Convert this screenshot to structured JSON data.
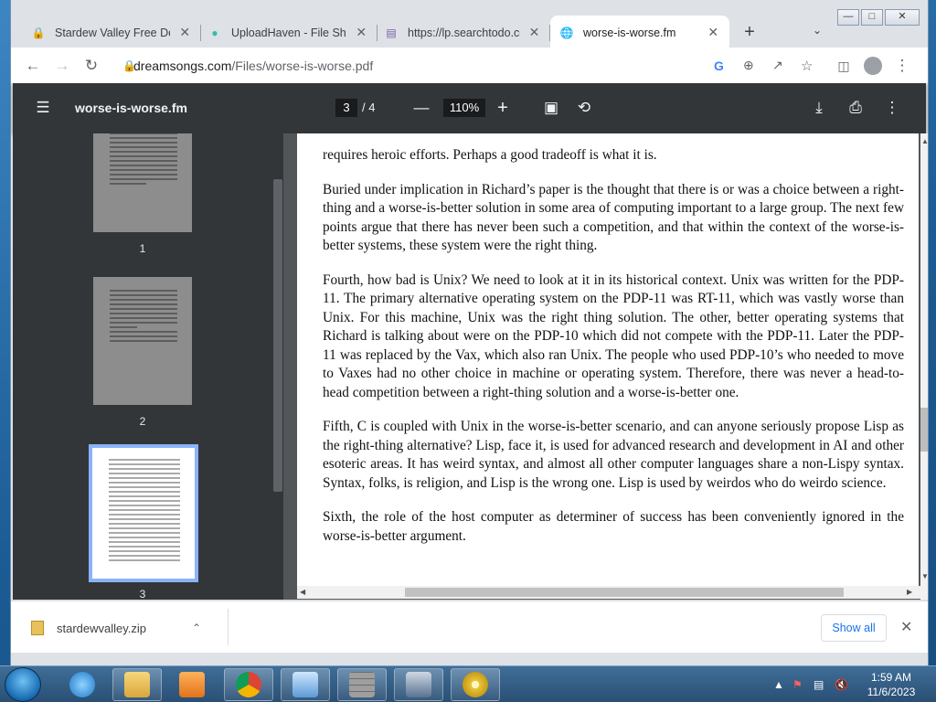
{
  "browser": {
    "tabs": [
      {
        "title": "Stardew Valley Free Dow",
        "icon": "lock-icon",
        "icon_color": "#a142f4"
      },
      {
        "title": "UploadHaven - File Shar",
        "icon": "uploadhaven-icon",
        "icon_color": "#2fc0a8"
      },
      {
        "title": "https://lp.searchtodo.co",
        "icon": "page-icon",
        "icon_color": "#7b5ea7"
      },
      {
        "title": "worse-is-worse.fm",
        "icon": "globe-icon",
        "active": true
      }
    ],
    "address": {
      "host": "dreamsongs.com",
      "path": "/Files/worse-is-worse.pdf"
    }
  },
  "pdf": {
    "title": "worse-is-worse.fm",
    "current_page": "3",
    "total_pages": "/  4",
    "zoom": "110%",
    "thumbnails": [
      {
        "label": "1"
      },
      {
        "label": "2"
      },
      {
        "label": "3",
        "selected": true
      }
    ],
    "paragraphs": [
      "requires heroic efforts. Perhaps a good tradeoff is what it is.",
      "Buried under implication in Richard’s paper is the thought that there is or was a choice between a right-thing and a worse-is-better solution in some area of computing important to a large group. The next few points argue that there has never been such a competition, and that within the context of the worse-is-better systems, these system were the right thing.",
      "Fourth, how bad is Unix? We need to look at it in its historical context. Unix was written for the PDP-11. The primary alternative operating system on the PDP-11 was RT-11, which was vastly worse than Unix. For this machine, Unix was the right thing solution. The other, better operating systems that Richard is talking about were on the PDP-10 which did not compete with the PDP-11. Later the PDP-11 was replaced by the Vax, which also ran Unix. The people who used PDP-10’s who needed to move to Vaxes had no other choice in machine or operating system. Therefore, there was never a head-to-head competition between a right-thing solution and a worse-is-better one.",
      "Fifth, C is coupled with Unix in the worse-is-better scenario, and can anyone seriously propose Lisp as the right-thing alternative? Lisp, face it, is used for advanced research and development in AI and other esoteric areas. It has weird syntax, and almost all other computer languages share a non-Lispy syntax. Syntax, folks, is religion, and Lisp is the wrong one. Lisp is used by weirdos who do weirdo science.",
      "Sixth, the role of the host computer as determiner of success has been conveniently ignored in the worse-is-better argument."
    ]
  },
  "downloads": {
    "file": "stardewvalley.zip",
    "show_all": "Show all"
  },
  "taskbar": {
    "time": "1:59 AM",
    "date": "11/6/2023",
    "apps": [
      "ie-icon",
      "explorer-icon",
      "media-player-icon",
      "chrome-icon",
      "control-panel-icon",
      "firewall-icon",
      "network-icon",
      "dvd-icon"
    ]
  }
}
